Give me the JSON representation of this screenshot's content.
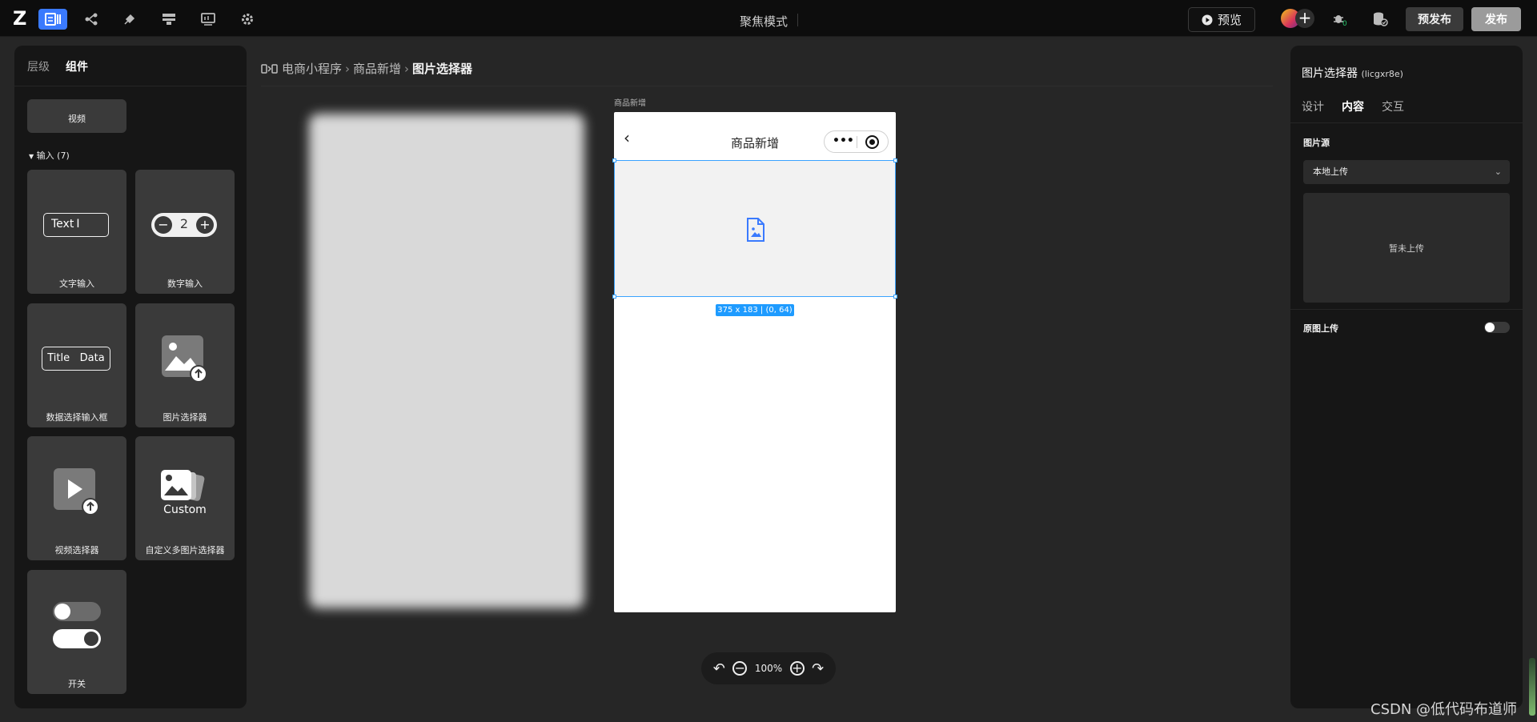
{
  "topbar": {
    "logo": "Z",
    "focus_mode": "聚焦模式",
    "preview_label": "预览",
    "prepublish_label": "预发布",
    "publish_label": "发布",
    "icons": [
      "pages-icon",
      "tree-icon",
      "plugin-icon",
      "layout-icon",
      "image-board-icon",
      "gear-icon"
    ],
    "accent": "#3a7afe"
  },
  "left_panel": {
    "tabs": [
      "层级",
      "组件"
    ],
    "video_label": "视频",
    "section_title": "输入 (7)",
    "components": {
      "text_input": {
        "preview": "Text",
        "label": "文字输入"
      },
      "number_input": {
        "preview": "2",
        "label": "数字输入"
      },
      "data_select": {
        "preview_title": "Title",
        "preview_data": "Data",
        "label": "数据选择输入框"
      },
      "image_picker": {
        "label": "图片选择器"
      },
      "video_picker": {
        "label": "视频选择器"
      },
      "custom_multi_image": {
        "preview": "Custom",
        "label": "自定义多图片选择器"
      },
      "switch": {
        "label": "开关"
      }
    }
  },
  "breadcrumb": {
    "items": [
      "电商小程序",
      "商品新增",
      "图片选择器"
    ]
  },
  "canvas": {
    "page_name": "商品新增",
    "nav_title": "商品新增",
    "dimension_tag": "375 x 183 | (0, 64)",
    "zoom": "100%"
  },
  "right_panel": {
    "title": "图片选择器",
    "id": "(licgxr8e)",
    "tabs": [
      "设计",
      "内容",
      "交互"
    ],
    "image_source_label": "图片源",
    "image_source_value": "本地上传",
    "upload_placeholder": "暂未上传",
    "original_upload_label": "原图上传"
  },
  "watermark": "CSDN @低代码布道师"
}
